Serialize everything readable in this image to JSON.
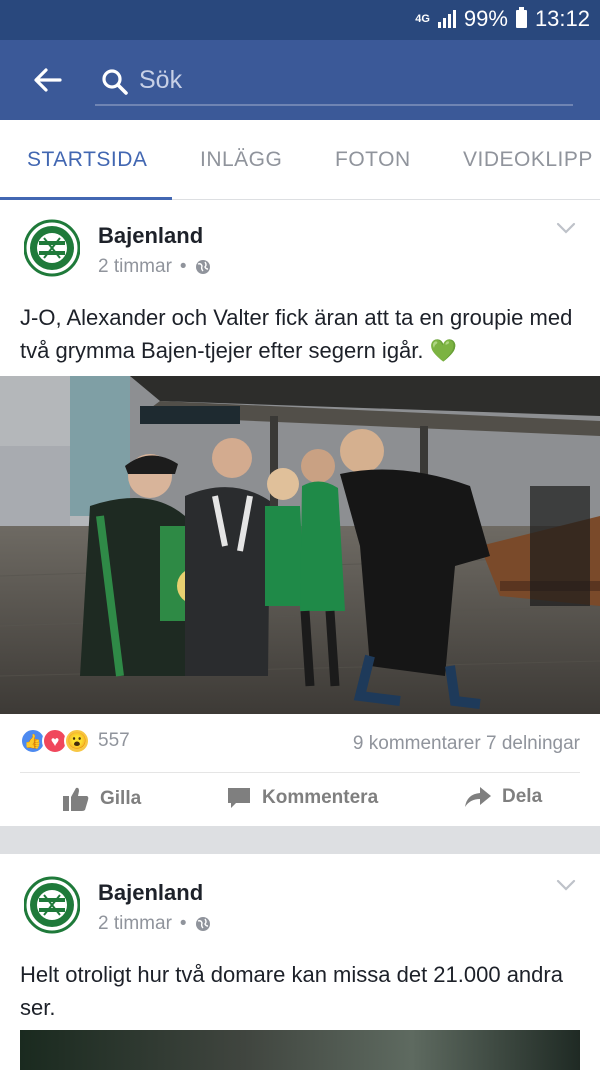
{
  "status_bar": {
    "network": "4G",
    "battery": "99%",
    "time": "13:12"
  },
  "search": {
    "placeholder": "Sök"
  },
  "tabs": [
    {
      "label": "STARTSIDA",
      "active": true
    },
    {
      "label": "INLÄGG"
    },
    {
      "label": "FOTON"
    },
    {
      "label": "VIDEOKLIPP"
    }
  ],
  "posts": [
    {
      "author": "Bajenland",
      "time": "2 timmar",
      "separator": "•",
      "text": "J-O, Alexander och Valter fick äran att ta en groupie med två grymma Bajen-tjejer efter segern igår. 💚",
      "reactions": {
        "icons": [
          "like-icon",
          "love-icon",
          "wow-icon"
        ],
        "count": "557"
      },
      "stats": "9 kommentarer 7 delningar",
      "actions": {
        "like": "Gilla",
        "comment": "Kommentera",
        "share": "Dela"
      }
    },
    {
      "author": "Bajenland",
      "time": "2 timmar",
      "separator": "•",
      "text": "Helt otroligt hur två domare kan missa det 21.000 andra ser."
    }
  ],
  "colors": {
    "header_dark": "#29487d",
    "header": "#3b5998",
    "accent": "#4267b2",
    "club_green": "#1f7a3a"
  }
}
